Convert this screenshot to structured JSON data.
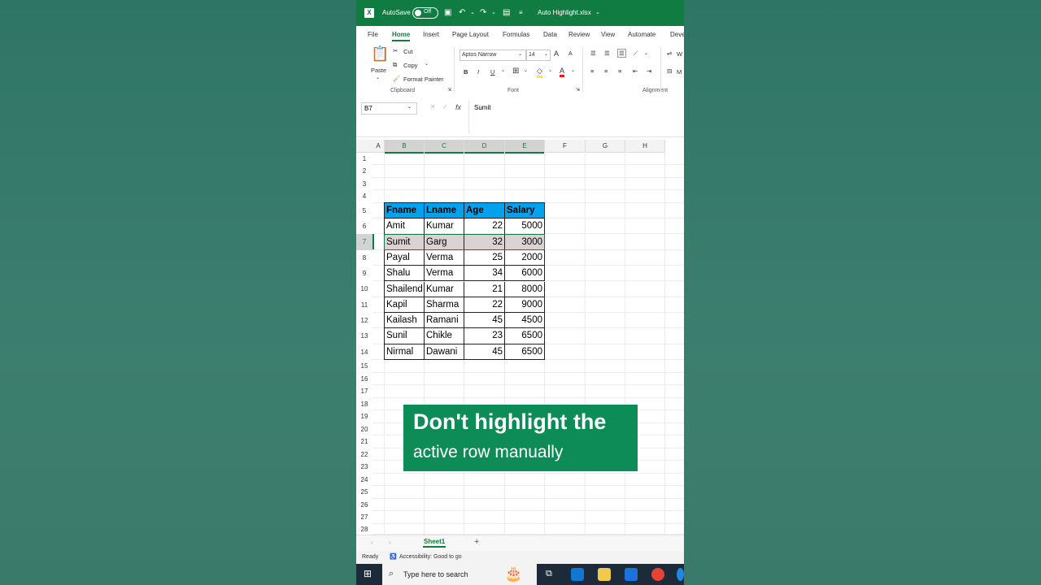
{
  "titlebar": {
    "app_icon": "X",
    "autosave_label": "AutoSave",
    "autosave_state": "Off",
    "file_name": "Auto Highlight.xlsx"
  },
  "menu_tabs": [
    "File",
    "Home",
    "Insert",
    "Page Layout",
    "Formulas",
    "Data",
    "Review",
    "View",
    "Automate",
    "Deve"
  ],
  "ribbon": {
    "paste": "Paste",
    "cut": "Cut",
    "copy": "Copy",
    "format_painter": "Format Painter",
    "clipboard": "Clipboard",
    "font_name": "Aptos Narrow",
    "font_size": "14",
    "grow_font": "A",
    "shrink_font": "A",
    "bold": "B",
    "italic": "I",
    "underline": "U",
    "font_color_glyph": "A",
    "font_group": "Font",
    "alignment_group": "Alignment",
    "wrap_glyph": "W",
    "merge_glyph": "M"
  },
  "formula_bar": {
    "name_box": "B7",
    "fx": "fx",
    "value": "Sumit"
  },
  "grid": {
    "columns": [
      "A",
      "B",
      "C",
      "D",
      "E",
      "F",
      "G",
      "H"
    ],
    "rows": [
      "1",
      "2",
      "3",
      "4",
      "5",
      "6",
      "7",
      "8",
      "9",
      "10",
      "11",
      "12",
      "13",
      "14",
      "15",
      "16",
      "17",
      "18",
      "19",
      "20",
      "21",
      "22",
      "23",
      "24",
      "25",
      "26",
      "27",
      "28"
    ]
  },
  "table": {
    "headers": [
      "Fname",
      "Lname",
      "Age",
      "Salary"
    ],
    "rows": [
      [
        "Amit",
        "Kumar",
        "22",
        "5000"
      ],
      [
        "Sumit",
        "Garg",
        "32",
        "3000"
      ],
      [
        "Payal",
        "Verma",
        "25",
        "2000"
      ],
      [
        "Shalu",
        "Verma",
        "34",
        "6000"
      ],
      [
        "Shailend",
        "Kumar",
        "21",
        "8000"
      ],
      [
        "Kapil",
        "Sharma",
        "22",
        "9000"
      ],
      [
        "Kailash",
        "Ramani",
        "45",
        "4500"
      ],
      [
        "Sunil",
        "Chikle",
        "23",
        "6500"
      ],
      [
        "Nirmal",
        "Dawani",
        "45",
        "6500"
      ]
    ]
  },
  "overlay": {
    "line1": "Don't highlight the",
    "line2": "active row manually"
  },
  "sheets": {
    "active": "Sheet1",
    "add": "+"
  },
  "status": {
    "ready": "Ready",
    "accessibility": "Accessibility: Good to go"
  },
  "taskbar": {
    "search_placeholder": "Type here to search"
  },
  "colors": {
    "excel_green": "#107c41",
    "header_fill": "#00a2ed",
    "highlight_row": "#d9d4d3",
    "overlay_bg": "#0d8c57"
  }
}
